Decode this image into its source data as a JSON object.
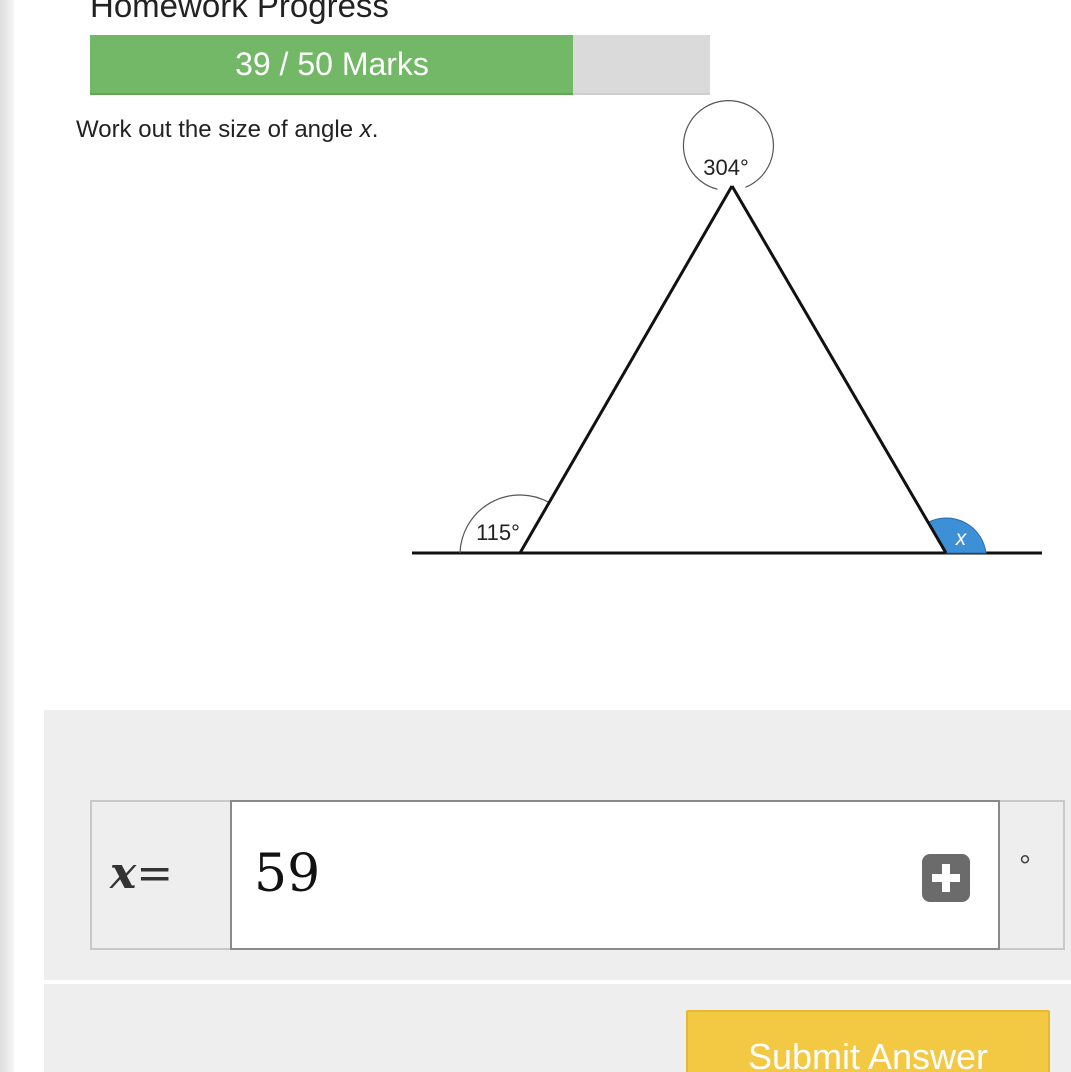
{
  "progress": {
    "title": "Homework Progress",
    "label": "39 / 50 Marks",
    "earned": 39,
    "total": 50,
    "fill_color": "#72b866"
  },
  "question": {
    "text": "Work out the size of angle ",
    "variable": "x",
    "suffix": "."
  },
  "diagram": {
    "angle_top": "304°",
    "angle_bottom_left": "115°",
    "angle_unknown": "x",
    "unknown_fill_color": "#3d8fd6"
  },
  "answer": {
    "variable_label": "x",
    "equals": "=",
    "value": "59",
    "unit": "°",
    "add_icon": "plus-square-icon"
  },
  "submit": {
    "label": "Submit Answer",
    "color": "#f3c842"
  }
}
